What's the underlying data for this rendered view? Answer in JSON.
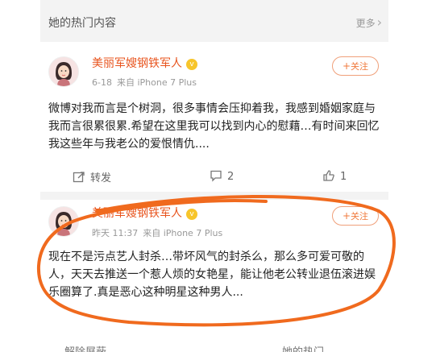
{
  "section": {
    "title": "她的热门内容",
    "more_label": "更多"
  },
  "posts": [
    {
      "username": "美丽军嫂钢铁军人",
      "badge": "v",
      "time": "6-18",
      "source": "来自 iPhone 7 Plus",
      "follow_label": "关注",
      "text": "微博对我而言是个树洞，很多事情会压抑着我，我感到婚姻家庭与我而言很累很累.希望在这里我可以找到内心的慰藉…有时间来回忆我这些年与我老公的爱恨情仇....",
      "repost_label": "转发",
      "comment_count": "2",
      "like_count": "1"
    },
    {
      "username": "美丽军嫂钢铁军人",
      "badge": "v",
      "time": "昨天 11:37",
      "source": "来自 iPhone 7 Plus",
      "follow_label": "关注",
      "text": "现在不是污点艺人封杀…带坏风气的封杀么，那么多可爱可敬的人，天天去推送一个惹人烦的女艳星，能让他老公转业退伍滚进娱乐圈算了.真是恶心这种明星这种男人...",
      "partial_actions": [
        "解除屏蔽",
        "她的热门"
      ]
    }
  ],
  "colors": {
    "username": "#e8541e",
    "follow_border": "#f0a07a",
    "annotation_stroke": "#f06a1e"
  }
}
